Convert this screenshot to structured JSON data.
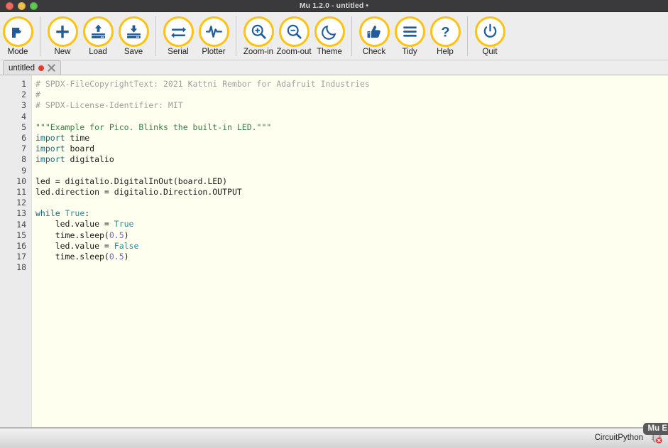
{
  "window": {
    "title": "Mu 1.2.0 - untitled •",
    "traffic_lights": [
      "close",
      "minimize",
      "zoom"
    ],
    "colors": {
      "titlebar_bg": "#3a3a3c",
      "toolbar_bg": "#ededed",
      "accent_yellow": "#ffc20e",
      "icon_blue": "#1f5c99",
      "editor_bg": "#fffff0",
      "gutter_bg": "#ebebeb",
      "modified_dot": "#e8392f"
    }
  },
  "toolbar": {
    "buttons": [
      {
        "label": "Mode",
        "icon": "mode-icon"
      },
      {
        "label": "New",
        "icon": "plus-icon"
      },
      {
        "label": "Load",
        "icon": "load-upload-icon"
      },
      {
        "label": "Save",
        "icon": "save-download-icon"
      },
      {
        "label": "Serial",
        "icon": "serial-arrows-icon"
      },
      {
        "label": "Plotter",
        "icon": "plotter-waveform-icon"
      },
      {
        "label": "Zoom-in",
        "icon": "zoom-in-magnifier-icon"
      },
      {
        "label": "Zoom-out",
        "icon": "zoom-out-magnifier-icon"
      },
      {
        "label": "Theme",
        "icon": "moon-icon"
      },
      {
        "label": "Check",
        "icon": "thumbs-up-icon"
      },
      {
        "label": "Tidy",
        "icon": "hamburger-lines-icon"
      },
      {
        "label": "Help",
        "icon": "question-mark-icon"
      },
      {
        "label": "Quit",
        "icon": "power-icon"
      }
    ]
  },
  "tabs": [
    {
      "label": "untitled",
      "modified": true,
      "close_icon": "close-x-icon"
    }
  ],
  "editor": {
    "first_line_number": 1,
    "line_count": 18,
    "lines": [
      [
        {
          "t": "# SPDX-FileCopyrightText: 2021 Kattni Rembor for Adafruit Industries",
          "c": "comment"
        }
      ],
      [
        {
          "t": "#",
          "c": "comment"
        }
      ],
      [
        {
          "t": "# SPDX-License-Identifier: MIT",
          "c": "comment"
        }
      ],
      [
        {
          "t": "",
          "c": "plain"
        }
      ],
      [
        {
          "t": "\"\"\"Example for Pico. Blinks the built-in LED.\"\"\"",
          "c": "string"
        }
      ],
      [
        {
          "t": "import",
          "c": "kw"
        },
        {
          "t": " time",
          "c": "plain"
        }
      ],
      [
        {
          "t": "import",
          "c": "kw"
        },
        {
          "t": " board",
          "c": "plain"
        }
      ],
      [
        {
          "t": "import",
          "c": "kw"
        },
        {
          "t": " digitalio",
          "c": "plain"
        }
      ],
      [
        {
          "t": "",
          "c": "plain"
        }
      ],
      [
        {
          "t": "led = digitalio.DigitalInOut(board.LED)",
          "c": "plain"
        }
      ],
      [
        {
          "t": "led.direction = digitalio.Direction.OUTPUT",
          "c": "plain"
        }
      ],
      [
        {
          "t": "",
          "c": "plain"
        }
      ],
      [
        {
          "t": "while",
          "c": "kw"
        },
        {
          "t": " ",
          "c": "plain"
        },
        {
          "t": "True",
          "c": "kw2"
        },
        {
          "t": ":",
          "c": "plain"
        }
      ],
      [
        {
          "t": "    led.value = ",
          "c": "plain"
        },
        {
          "t": "True",
          "c": "kw2"
        }
      ],
      [
        {
          "t": "    time.sleep(",
          "c": "plain"
        },
        {
          "t": "0.5",
          "c": "num"
        },
        {
          "t": ")",
          "c": "plain"
        }
      ],
      [
        {
          "t": "    led.value = ",
          "c": "plain"
        },
        {
          "t": "False",
          "c": "kw2"
        }
      ],
      [
        {
          "t": "    time.sleep(",
          "c": "plain"
        },
        {
          "t": "0.5",
          "c": "num"
        },
        {
          "t": ")",
          "c": "plain"
        }
      ],
      [
        {
          "t": "",
          "c": "plain"
        }
      ]
    ]
  },
  "statusbar": {
    "mode_label": "CircuitPython",
    "device_icon": "microchip-disconnected-icon",
    "device_connected": false,
    "tooltip_text": "Mu E"
  }
}
